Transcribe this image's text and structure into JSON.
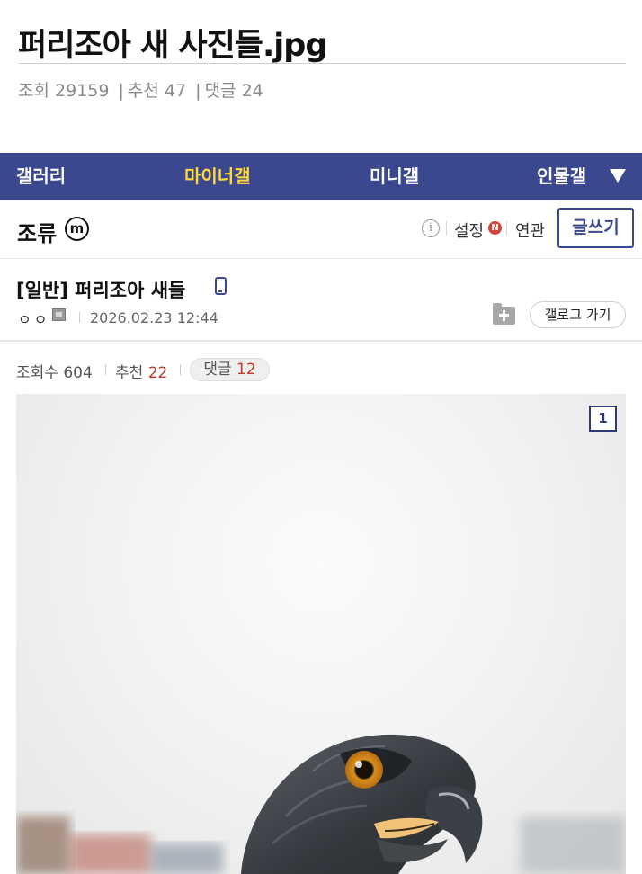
{
  "post_outer": {
    "title": "퍼리조아 새 사진들.jpg",
    "views_label": "조회",
    "views": "29159",
    "recommend_label": "추천",
    "recommend": "47",
    "comments_label": "댓글",
    "comments": "24",
    "separator": "|"
  },
  "gallery_nav": {
    "items": [
      {
        "label": "갤러리",
        "active": false
      },
      {
        "label": "마이너갤",
        "active": true
      },
      {
        "label": "미니갤",
        "active": false
      },
      {
        "label": "인물갤",
        "active": false
      }
    ],
    "accent_color": "#ffd83a",
    "bar_color": "#3b4890"
  },
  "gallery_bar": {
    "name": "조류",
    "badge": "m",
    "info_icon": "i",
    "settings_label": "설정",
    "new_badge": "N",
    "related_label": "연관",
    "write_button": "글쓰기"
  },
  "post": {
    "title": "[일반] 퍼리조아 새들",
    "author": "ㅇㅇ",
    "date": "2026.02.23 12:44",
    "gallog_button": "갤로그 가기"
  },
  "post_stats": {
    "views_label": "조회수",
    "views": "604",
    "recommend_label": "추천",
    "recommend": "22",
    "comments_label": "댓글",
    "comments": "12"
  },
  "image": {
    "index_badge": "1"
  }
}
